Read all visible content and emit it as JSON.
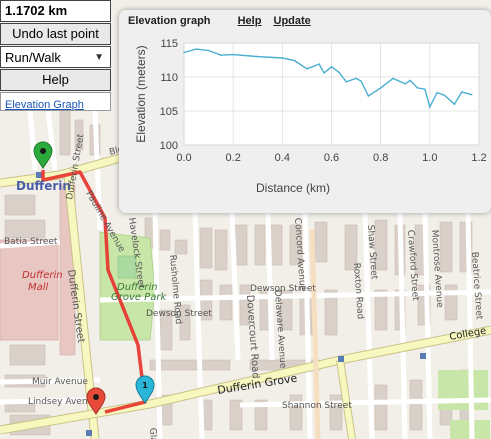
{
  "controls": {
    "distance": "1.1702 km",
    "undo_label": "Undo last point",
    "mode_selected": "Run/Walk",
    "help_label": "Help",
    "elevation_link": "Elevation Graph"
  },
  "elevation_panel": {
    "title": "Elevation graph",
    "help_link": "Help",
    "update_link": "Update"
  },
  "chart_data": {
    "type": "line",
    "xlabel": "Distance (km)",
    "ylabel": "Elevation (meters)",
    "xlim": [
      0,
      1.2
    ],
    "ylim": [
      100,
      115
    ],
    "xticks": [
      "0.0",
      "0.2",
      "0.4",
      "0.6",
      "0.8",
      "1.0",
      "1.2"
    ],
    "yticks": [
      "100",
      "105",
      "110",
      "115"
    ],
    "x": [
      0.0,
      0.05,
      0.1,
      0.15,
      0.2,
      0.3,
      0.4,
      0.45,
      0.5,
      0.55,
      0.57,
      0.6,
      0.63,
      0.66,
      0.7,
      0.72,
      0.75,
      0.8,
      0.85,
      0.9,
      0.92,
      0.95,
      0.98,
      1.0,
      1.03,
      1.06,
      1.1,
      1.13,
      1.17
    ],
    "y": [
      113.6,
      114.1,
      113.9,
      113.2,
      113.3,
      113.0,
      112.8,
      112.4,
      111.2,
      111.9,
      110.6,
      111.5,
      110.7,
      109.3,
      109.8,
      109.4,
      107.2,
      108.4,
      109.8,
      109.0,
      109.5,
      108.4,
      108.2,
      105.6,
      107.7,
      107.3,
      106.0,
      107.8,
      107.4
    ],
    "line_color": "#4aaed0",
    "grid": true
  },
  "map": {
    "street_labels": {
      "bloor": "Bloor Street",
      "dufferin_station": "Dufferin",
      "dufferin_street": "Dufferin Street",
      "dufferin_mall": "Dufferin Mall",
      "dufferin_grove_park": "Dufferin Grove Park",
      "dufferin_grove": "Dufferin Grove",
      "college": "College",
      "dewson": "Dewson Street",
      "muir": "Muir Avenue",
      "lindsey": "Lindsey Avenue",
      "shannon": "Shannon Street",
      "havelock": "Havelock Street",
      "rusholme": "Rusholme Road",
      "dovercourt": "Dovercourt Road",
      "delaware": "Delaware Avenue",
      "concord": "Concord Avenue",
      "roxton": "Roxton Road",
      "shaw": "Shaw Street",
      "crawford": "Crawford Street",
      "montrose": "Montrose Avenue",
      "beatrice": "Beatrice Street",
      "pauline": "Pauline Avenue",
      "batia": "Batia Street",
      "glad": "Glad"
    },
    "marker_end_number": "1",
    "colors": {
      "route": "#e8302a",
      "start_marker": "#2bab3c",
      "end_marker": "#29b6d8",
      "other_marker": "#e84a3a",
      "park": "#c8e6a8",
      "mall": "#e8c6c2",
      "major_road": "#f7f7c0"
    }
  }
}
